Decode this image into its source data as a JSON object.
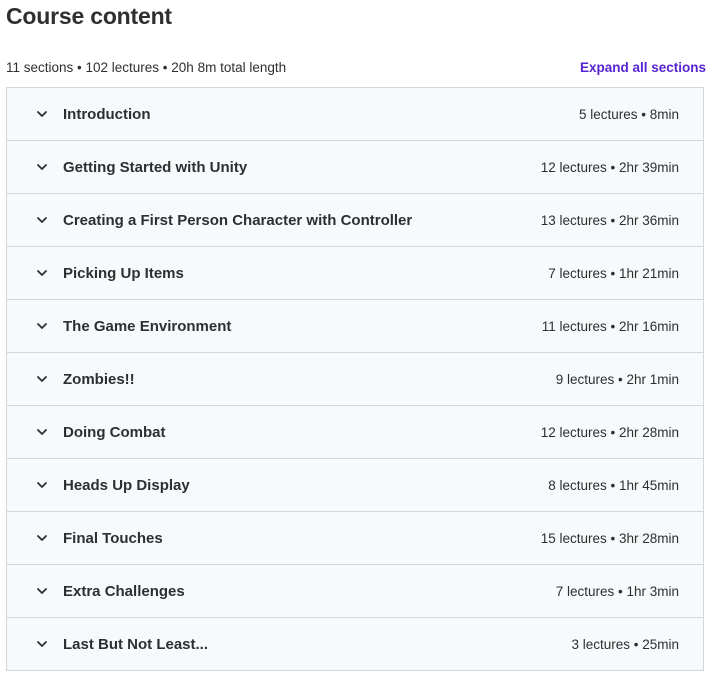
{
  "header": {
    "title": "Course content",
    "summary": "11 sections • 102 lectures • 20h 8m total length",
    "expand_all_label": "Expand all sections"
  },
  "colors": {
    "accent": "#5624d0",
    "row_background": "#f7f9fa",
    "border": "#d1d7dc",
    "text": "#2d2f31"
  },
  "sections": [
    {
      "title": "Introduction",
      "meta": "5 lectures • 8min",
      "icon": "chevron-down-icon"
    },
    {
      "title": "Getting Started with Unity",
      "meta": "12 lectures • 2hr 39min",
      "icon": "chevron-down-icon"
    },
    {
      "title": "Creating a First Person Character with Controller",
      "meta": "13 lectures • 2hr 36min",
      "icon": "chevron-down-icon"
    },
    {
      "title": "Picking Up Items",
      "meta": "7 lectures • 1hr 21min",
      "icon": "chevron-down-icon"
    },
    {
      "title": "The Game Environment",
      "meta": "11 lectures • 2hr 16min",
      "icon": "chevron-down-icon"
    },
    {
      "title": "Zombies!!",
      "meta": "9 lectures • 2hr 1min",
      "icon": "chevron-down-icon"
    },
    {
      "title": "Doing Combat",
      "meta": "12 lectures • 2hr 28min",
      "icon": "chevron-down-icon"
    },
    {
      "title": "Heads Up Display",
      "meta": "8 lectures • 1hr 45min",
      "icon": "chevron-down-icon"
    },
    {
      "title": "Final Touches",
      "meta": "15 lectures • 3hr 28min",
      "icon": "chevron-down-icon"
    },
    {
      "title": "Extra Challenges",
      "meta": "7 lectures • 1hr 3min",
      "icon": "chevron-down-icon"
    },
    {
      "title": "Last But Not Least...",
      "meta": "3 lectures • 25min",
      "icon": "chevron-down-icon"
    }
  ]
}
